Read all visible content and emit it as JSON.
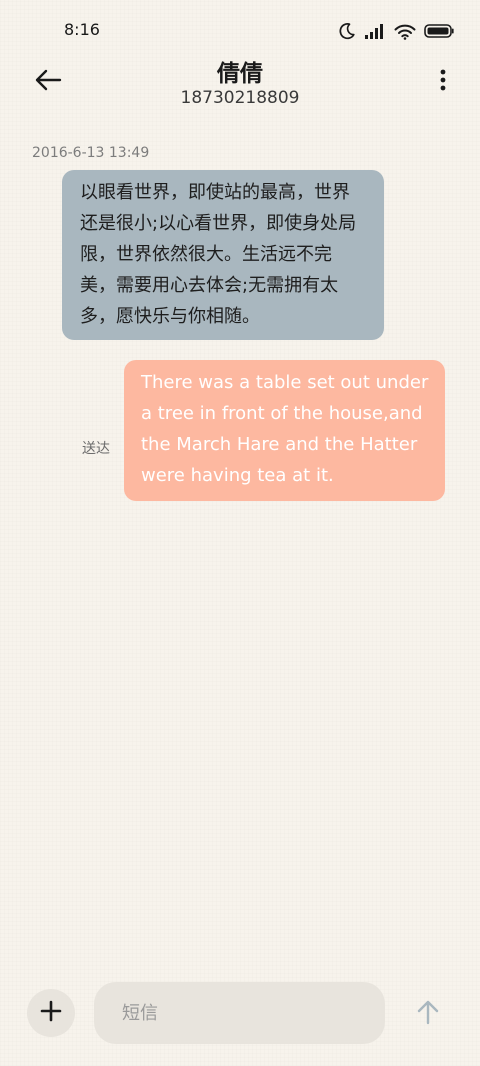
{
  "status_bar": {
    "time": "8:16",
    "icons": [
      "moon-icon",
      "signal-icon",
      "wifi-icon",
      "battery-icon"
    ]
  },
  "header": {
    "back_icon": "arrow-left-icon",
    "contact_name": "倩倩",
    "contact_number": "18730218809",
    "more_icon": "more-vertical-icon"
  },
  "conversation": {
    "timestamp": "2016-6-13 13:49",
    "messages": [
      {
        "direction": "incoming",
        "text": "以眼看世界，即使站的最高，世界还是很小;以心看世界，即使身处局限，世界依然很大。生活远不完美，需要用心去体会;无需拥有太多，愿快乐与你相随。"
      },
      {
        "direction": "outgoing",
        "status": "送达",
        "text": "There was a table set out under a tree in front of the house,and the March Hare and the Hatter were having tea at it."
      }
    ]
  },
  "composer": {
    "attach_icon": "plus-icon",
    "placeholder": "短信",
    "value": "",
    "send_icon": "arrow-up-icon"
  },
  "colors": {
    "background": "#f7f3ec",
    "incoming_bubble": "#a9b7bf",
    "outgoing_bubble": "#fdb8a0",
    "input_background": "#e8e4dd",
    "send_icon": "#a9b7bf"
  }
}
